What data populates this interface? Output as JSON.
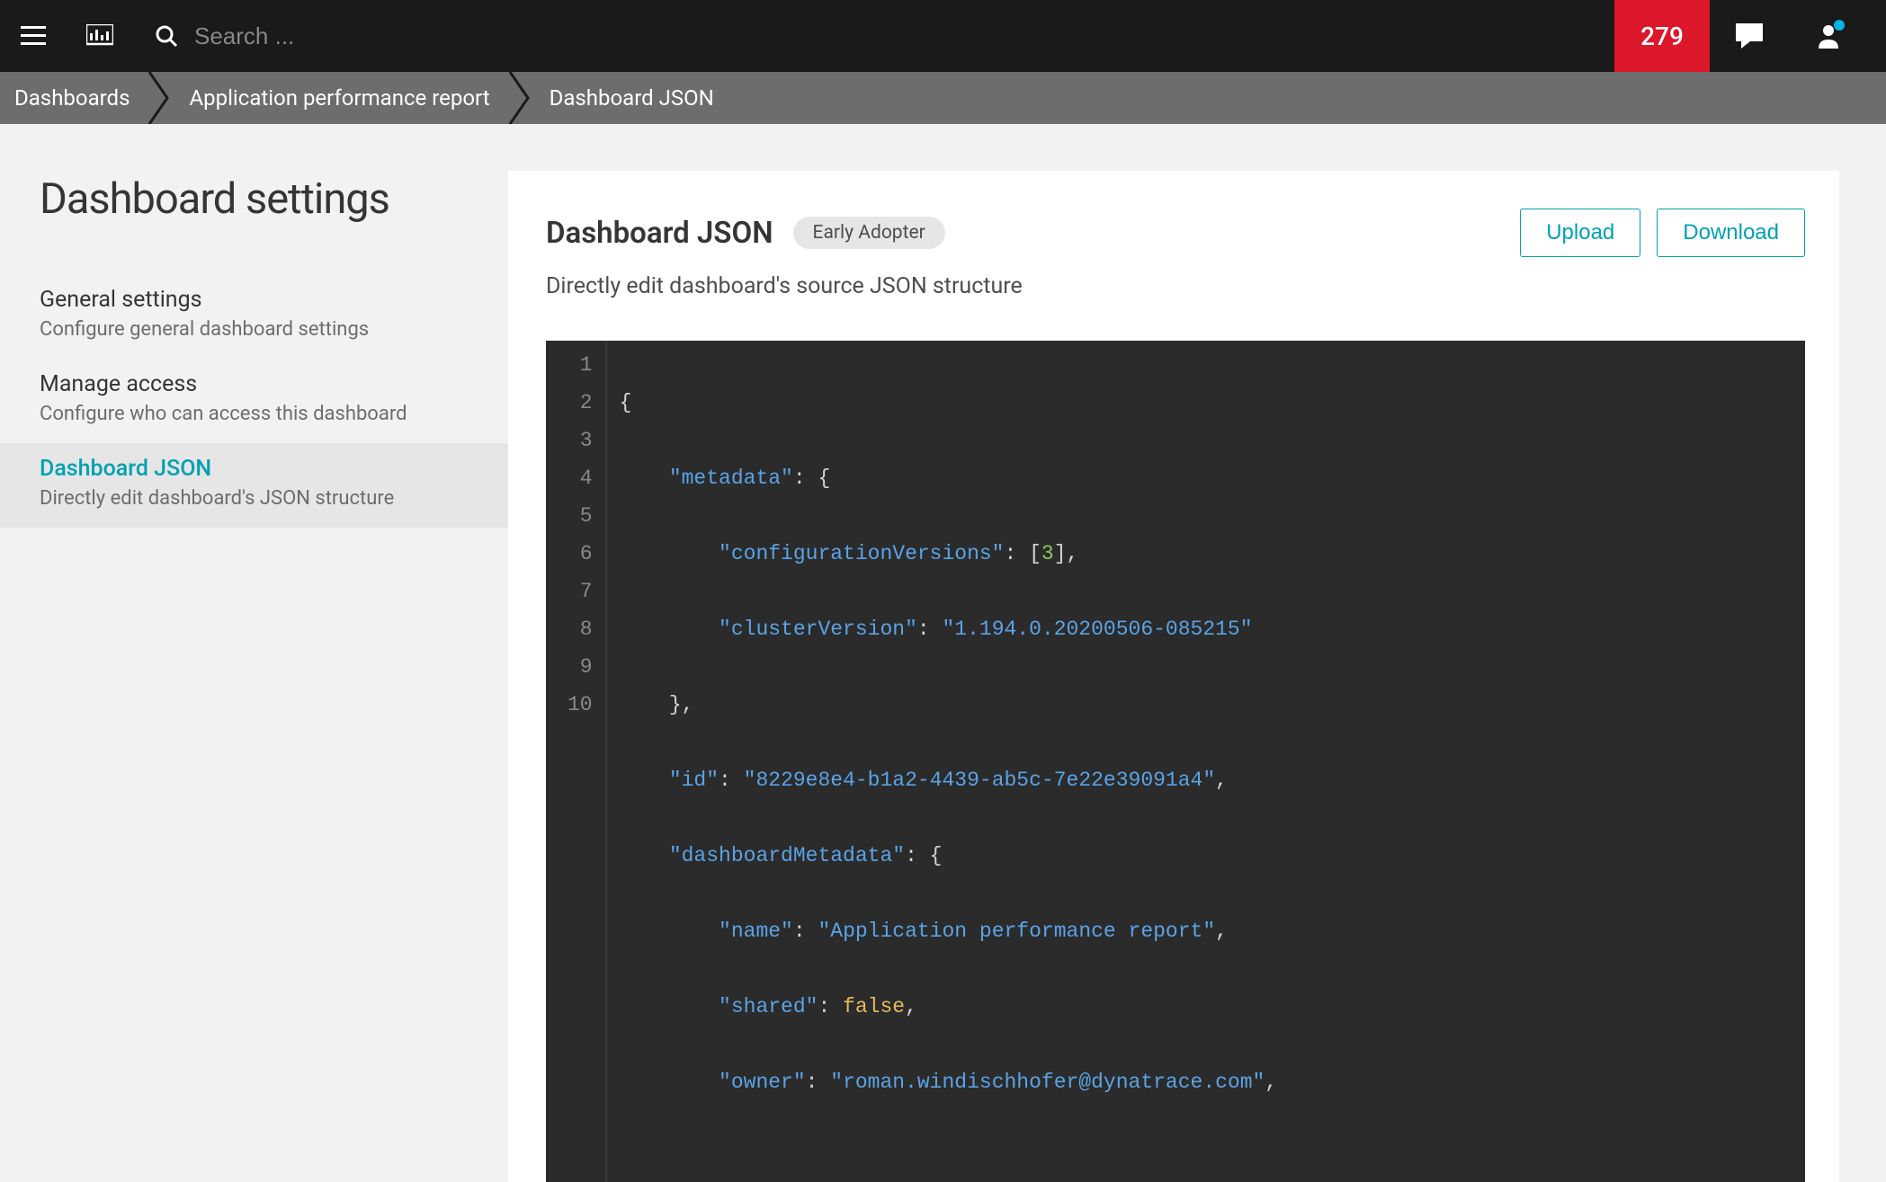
{
  "topbar": {
    "search_placeholder": "Search ...",
    "notification_count": "279"
  },
  "breadcrumb": {
    "items": [
      "Dashboards",
      "Application performance report",
      "Dashboard JSON"
    ]
  },
  "sidebar": {
    "title": "Dashboard settings",
    "items": [
      {
        "title": "General settings",
        "desc": "Configure general dashboard settings"
      },
      {
        "title": "Manage access",
        "desc": "Configure who can access this dashboard"
      },
      {
        "title": "Dashboard JSON",
        "desc": "Directly edit dashboard's JSON structure"
      }
    ]
  },
  "main": {
    "title": "Dashboard JSON",
    "badge": "Early Adopter",
    "subtitle": "Directly edit dashboard's source JSON structure",
    "upload_label": "Upload",
    "download_label": "Download"
  },
  "editor": {
    "line_numbers": [
      "1",
      "2",
      "3",
      "4",
      "5",
      "6",
      "7",
      "8",
      "9",
      "10"
    ],
    "json_content": {
      "metadata": {
        "configurationVersions": [
          3
        ],
        "clusterVersion": "1.194.0.20200506-085215"
      },
      "id": "8229e8e4-b1a2-4439-ab5c-7e22e39091a4",
      "dashboardMetadata": {
        "name": "Application performance report",
        "shared": false,
        "owner": "roman.windischhofer@dynatrace.com"
      }
    },
    "tokens": {
      "l1": "{",
      "l2_k": "\"metadata\"",
      "l2_r": ": {",
      "l3_k": "\"configurationVersions\"",
      "l3_b1": ": [",
      "l3_n": "3",
      "l3_b2": "],",
      "l4_k": "\"clusterVersion\"",
      "l4_c": ": ",
      "l4_v": "\"1.194.0.20200506-085215\"",
      "l5": "},",
      "l6_k": "\"id\"",
      "l6_c": ": ",
      "l6_v": "\"8229e8e4-b1a2-4439-ab5c-7e22e39091a4\"",
      "l6_e": ",",
      "l7_k": "\"dashboardMetadata\"",
      "l7_r": ": {",
      "l8_k": "\"name\"",
      "l8_c": ": ",
      "l8_v": "\"Application performance report\"",
      "l8_e": ",",
      "l9_k": "\"shared\"",
      "l9_c": ": ",
      "l9_v": "false",
      "l9_e": ",",
      "l10_k": "\"owner\"",
      "l10_c": ": ",
      "l10_v": "\"roman.windischhofer@dynatrace.com\"",
      "l10_e": ","
    }
  }
}
